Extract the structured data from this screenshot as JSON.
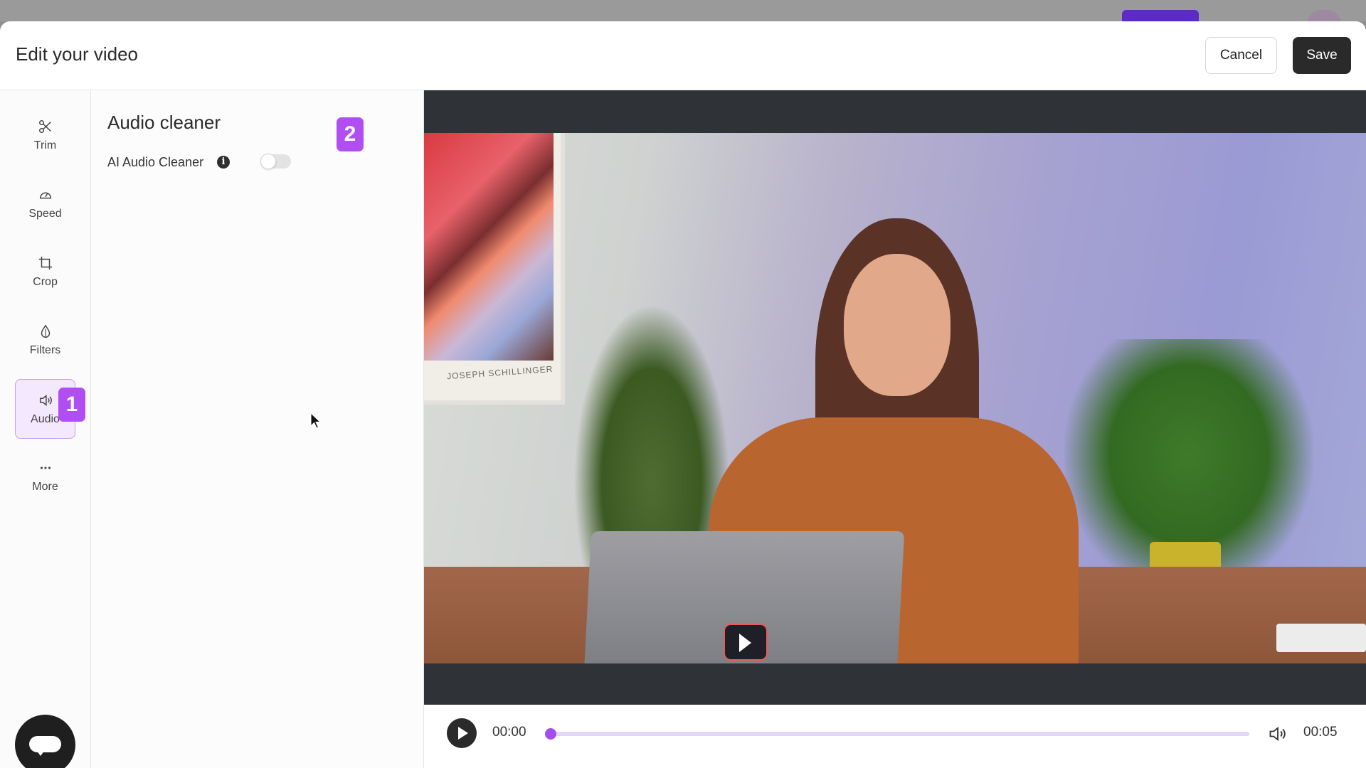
{
  "header": {
    "title": "Edit your video",
    "cancel_label": "Cancel",
    "save_label": "Save"
  },
  "rail": {
    "items": [
      {
        "label": "Trim",
        "icon": "scissors-icon"
      },
      {
        "label": "Speed",
        "icon": "speedometer-icon"
      },
      {
        "label": "Crop",
        "icon": "crop-icon"
      },
      {
        "label": "Filters",
        "icon": "drop-icon"
      },
      {
        "label": "Audio",
        "icon": "speaker-icon",
        "active": true
      },
      {
        "label": "More",
        "icon": "more-dots-icon"
      }
    ]
  },
  "badges": {
    "one": "1",
    "two": "2"
  },
  "panel": {
    "title": "Audio cleaner",
    "setting_label": "AI Audio Cleaner",
    "info_glyph": "i",
    "toggle_on": false
  },
  "video": {
    "poster_text": "JOSEPH SCHILLINGER",
    "current_time": "00:00",
    "duration": "00:05",
    "progress": 0
  },
  "colors": {
    "accent": "#b14ef2",
    "dark_button": "#2a2a2a",
    "scrubber_track": "#e3d6f4"
  }
}
